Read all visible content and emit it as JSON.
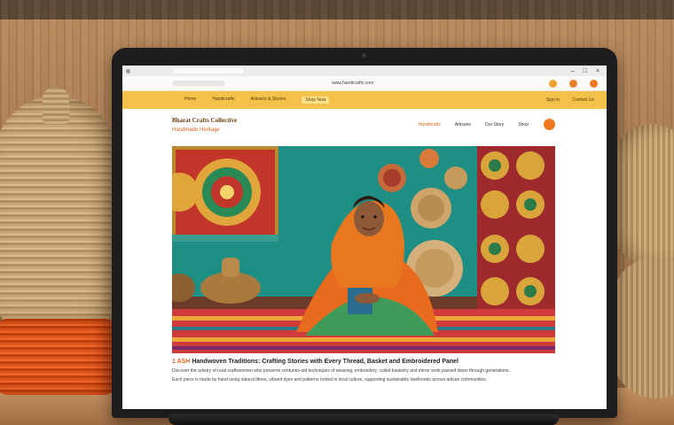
{
  "scene": {
    "subject": "laptop-showing-handicraft-website"
  },
  "browser": {
    "url_text": "www.handicrafts.com"
  },
  "site": {
    "navbar": {
      "links": [
        "Home",
        "Handicrafts",
        "Artisans & Stories"
      ],
      "highlight": "Shop Now",
      "right": [
        "Sign In",
        "Contact Us"
      ]
    },
    "brand": "Bharat Crafts Collective",
    "tagline": "Handmade Heritage",
    "nav": [
      "Handicrafts",
      "Artisans",
      "Our Story",
      "Shop"
    ],
    "hero_alt": "Artisan woman in orange saree seated among woven baskets and embroidered textiles",
    "article": {
      "headline_accent": "1 ASH",
      "headline_rest": "Handwoven Traditions: Crafting Stories with Every Thread, Basket and Embroidered Panel",
      "paragraph_1": "Discover the artistry of rural craftswomen who preserve centuries-old techniques of weaving, embroidery, coiled basketry and mirror work passed down through generations.",
      "paragraph_2": "Each piece is made by hand using natural fibres, vibrant dyes and patterns rooted in local culture, supporting sustainable livelihoods across artisan communities."
    }
  },
  "colors": {
    "navbar": "#f4c24a",
    "accent": "#e0621f",
    "hero_teal": "#1f8e85"
  }
}
